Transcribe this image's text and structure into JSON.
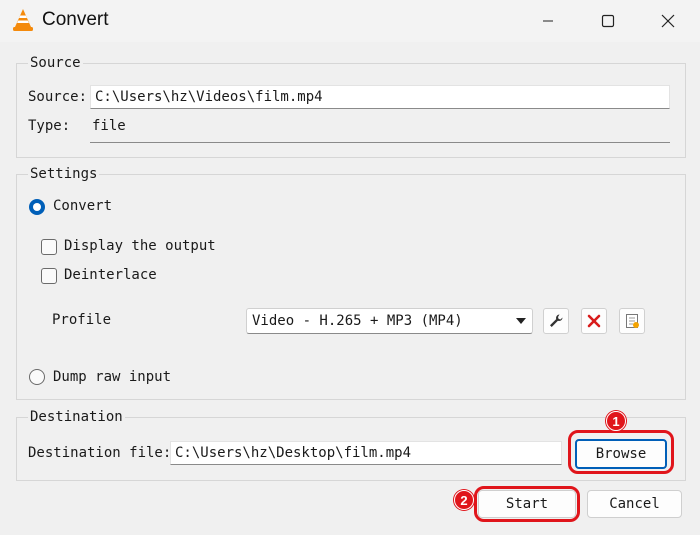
{
  "window": {
    "title": "Convert"
  },
  "source": {
    "group_label": "Source",
    "source_label": "Source:",
    "source_value": "C:\\Users\\hz\\Videos\\film.mp4",
    "type_label": "Type:",
    "type_value": "file"
  },
  "settings": {
    "group_label": "Settings",
    "convert_label": "Convert",
    "convert_selected": true,
    "display_output_label": "Display the output",
    "deinterlace_label": "Deinterlace",
    "profile_label": "Profile",
    "profile_value": "Video - H.265 + MP3 (MP4)",
    "dump_raw_label": "Dump raw input"
  },
  "destination": {
    "group_label": "Destination",
    "file_label": "Destination file:",
    "file_value": "C:\\Users\\hz\\Desktop\\film.mp4",
    "browse_label": "Browse"
  },
  "footer": {
    "start_label": "Start",
    "cancel_label": "Cancel"
  },
  "annotations": {
    "badge_1": "1",
    "badge_2": "2"
  },
  "colors": {
    "accent": "#005fb8",
    "annotation_red": "#e0151b",
    "delete_red": "#d81b1b"
  },
  "icons": [
    "vlc-cone-icon",
    "minimize-icon",
    "maximize-icon",
    "close-icon",
    "wrench-icon",
    "delete-icon",
    "new-profile-icon",
    "dropdown-arrow-icon"
  ]
}
